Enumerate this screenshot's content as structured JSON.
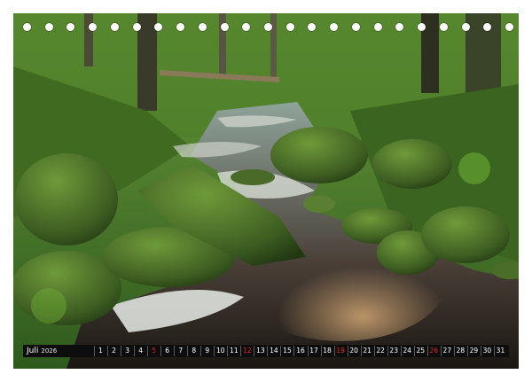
{
  "calendar": {
    "month": "Juli",
    "year": "2026",
    "days": [
      "1",
      "2",
      "3",
      "4",
      "5",
      "6",
      "7",
      "8",
      "9",
      "10",
      "11",
      "12",
      "13",
      "14",
      "15",
      "16",
      "17",
      "18",
      "19",
      "20",
      "21",
      "22",
      "23",
      "24",
      "25",
      "26",
      "27",
      "28",
      "29",
      "30",
      "31"
    ],
    "sundays": [
      "5",
      "12",
      "19",
      "26"
    ]
  },
  "binding": {
    "hole_count": 23
  },
  "colors": {
    "sunday": "#e02020",
    "bar": "#0d0d0d",
    "text": "#ffffff"
  }
}
